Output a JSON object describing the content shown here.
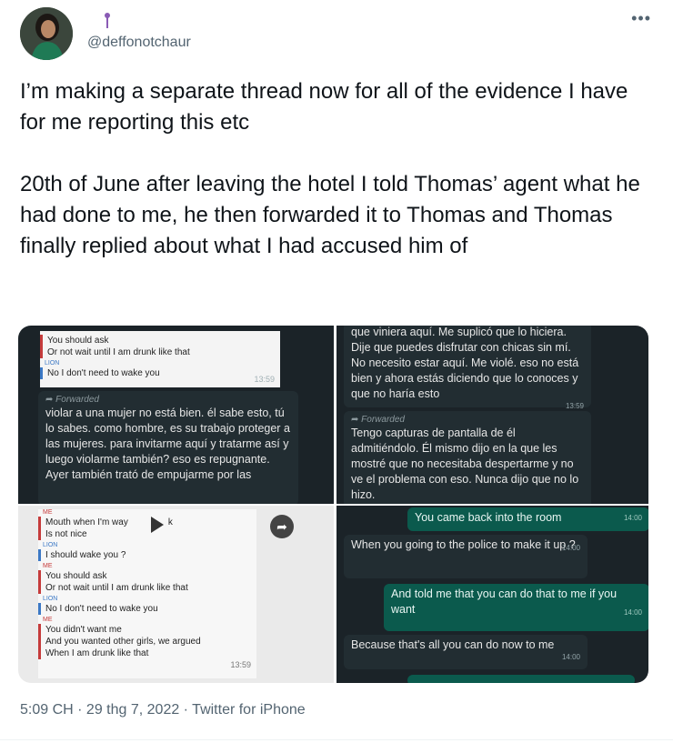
{
  "user": {
    "handle": "@deffonotchaur",
    "pin_icon": "pin-icon"
  },
  "tweet": {
    "paragraph1": "I’m making a separate thread now for all of the evidence I have for me reporting this etc",
    "paragraph2": "20th of June after leaving the hotel I told Thomas’ agent what he had done to me, he then forwarded it to Thomas and Thomas finally replied about what I had accused him of"
  },
  "media": {
    "tl": {
      "c1": "You should ask",
      "c2": "Or not wait until I am drunk like that",
      "who_lion": "LION",
      "c3": "No I don't need to wake you",
      "c_time": "13:59",
      "fwd_label": "Forwarded",
      "b_text": "violar a una mujer no está bien. él sabe esto, tú lo sabes. como hombre, es su trabajo proteger a las mujeres. para invitarme aquí y tratarme así y luego violarme también? eso es repugnante. Ayer también trató de empujarme por las"
    },
    "tr": {
      "b1_text": "que viniera aquí. Me suplicó que lo hiciera. Dije que puedes disfrutar con chicas sin mí. No necesito estar aquí. Me violé. eso no está bien y ahora estás diciendo que lo conoces y que no haría esto",
      "b1_time": "13:59",
      "fwd_label": "Forwarded",
      "b2_text": "Tengo capturas de pantalla de él admitiéndolo. Él mismo dijo en la que les mostré que no necesitaba despertarme y no ve el problema con eso. Nunca dijo que no lo hizo."
    },
    "bl": {
      "who_me": "ME",
      "r1": "Mouth when I'm way",
      "r1b": "k",
      "r2": "Is not nice",
      "who_lion": "LION",
      "r3": "I should wake you ?",
      "r4": "You should ask",
      "r5": "Or not wait until I am drunk like that",
      "r6": "No I don't need to wake you",
      "r7": "You didn't want me",
      "r8": "And you wanted other girls, we argued",
      "r9": "When I am drunk like that",
      "time": "13:59"
    },
    "br": {
      "m1": "You came back into the room",
      "m1_time": "14:00",
      "m2": "When you going to the police to make it up ?",
      "m2_time": "14:00",
      "m3": "And told me that you can do that to me if you want",
      "m3_time": "14:00",
      "m4": "Because that's all you can do now to me",
      "m4_time": "14:00"
    }
  },
  "footer": {
    "time": "5:09 CH",
    "sep1": " · ",
    "date": "29 thg 7, 2022",
    "sep2": " · ",
    "source": "Twitter for iPhone"
  }
}
